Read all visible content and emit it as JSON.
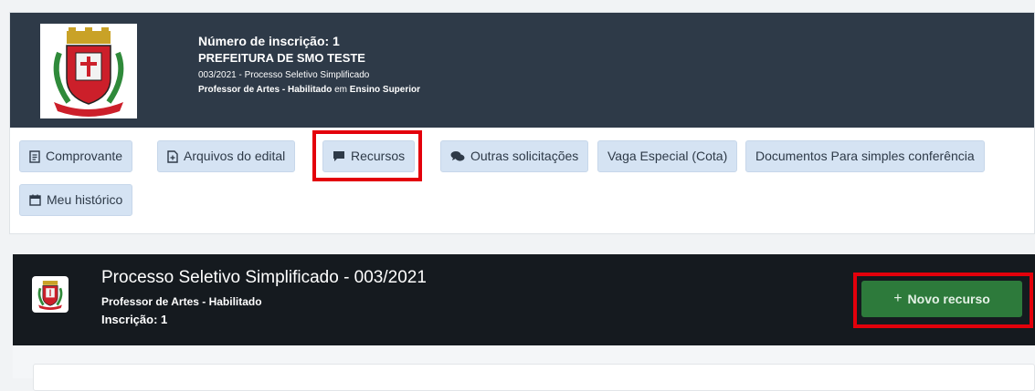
{
  "header": {
    "registration": "Número de inscrição: 1",
    "organization": "PREFEITURA DE SMO TESTE",
    "process": "003/2021 - Processo Seletivo Simplificado",
    "position": "Professor de Artes - Habilitado",
    "position_connector": " em ",
    "education": "Ensino Superior"
  },
  "buttons": {
    "comprovante": "Comprovante",
    "arquivos": "Arquivos do edital",
    "recursos": "Recursos",
    "outras": "Outras solicitações",
    "vaga": "Vaga Especial (Cota)",
    "documentos": "Documentos Para simples conferência",
    "historico": "Meu histórico"
  },
  "process_card": {
    "title": "Processo Seletivo Simplificado - 003/2021",
    "position": "Professor de Artes - Habilitado",
    "registration": "Inscrição: 1",
    "new_appeal_button": "Novo recurso"
  },
  "colors": {
    "header_bg": "#2e3a48",
    "card_header_bg": "#151a1f",
    "button_bg": "#d5e3f3",
    "success": "#2d7a3b",
    "highlight": "#e3000b"
  }
}
